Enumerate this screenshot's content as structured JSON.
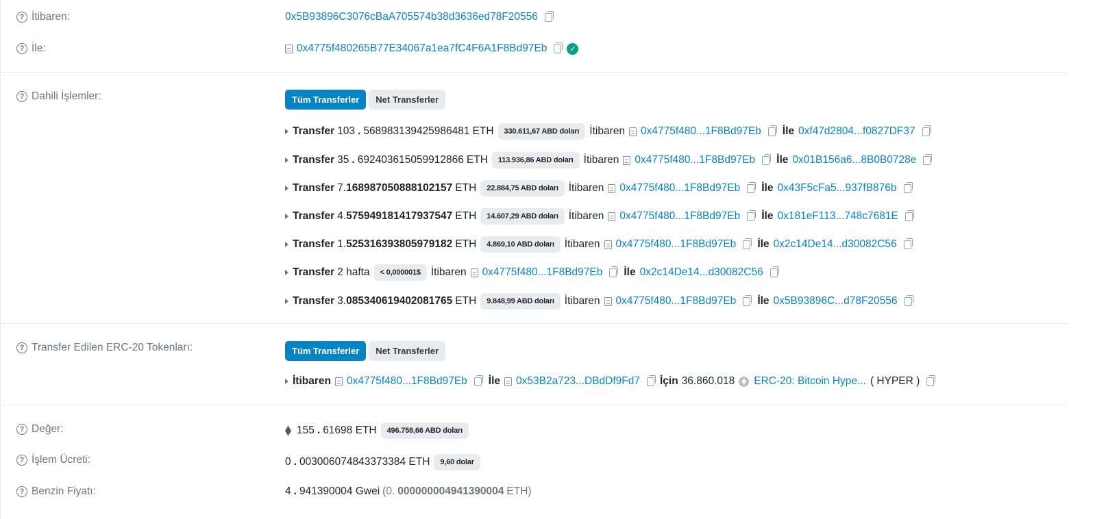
{
  "from": {
    "label": "İtibaren:",
    "address": "0x5B93896C3076cBaA705574b38d3636ed78F20556"
  },
  "to": {
    "label": "İle:",
    "address": "0x4775f480265B77E34067a1ea7fC4F6A1F8Bd97Eb"
  },
  "internal": {
    "label": "Dahili İşlemler:",
    "tab_all": "Tüm Transferler",
    "tab_net": "Net Transferler",
    "transfers": [
      {
        "word": "Transfer",
        "amount_a": "103",
        "amount_b": "568983139425986481",
        "unit": "ETH",
        "usd": "330.611,67 ABD doları",
        "from_label": "İtibaren",
        "from": "0x4775f480...1F8Bd97Eb",
        "to_label": "İle",
        "to": "0xf47d2804...f0827DF37"
      },
      {
        "word": "Transfer",
        "amount_a": "35",
        "amount_b": "692403615059912866",
        "unit": "ETH",
        "usd": "113.936,86 ABD doları",
        "from_label": "İtibaren",
        "from": "0x4775f480...1F8Bd97Eb",
        "to_label": "İle",
        "to": "0x01B156a6...8B0B0728e"
      },
      {
        "word": "Transfer",
        "amount_a": "7.",
        "amount_b": "168987050888102157",
        "unit": "ETH",
        "usd": "22.884,75 ABD doları",
        "from_label": "İtibaren",
        "from": "0x4775f480...1F8Bd97Eb",
        "to_label": "İle",
        "to": "0x43F5cFa5...937fB876b"
      },
      {
        "word": "Transfer",
        "amount_a": "4.",
        "amount_b": "575949181417937547",
        "unit": "ETH",
        "usd": "14.607,29 ABD doları",
        "from_label": "İtibaren",
        "from": "0x4775f480...1F8Bd97Eb",
        "to_label": "İle",
        "to": "0x181eF113...748c7681E"
      },
      {
        "word": "Transfer",
        "amount_a": "1.",
        "amount_b": "525316393805979182",
        "unit": "ETH",
        "usd": "4.869,10 ABD doları",
        "from_label": "İtibaren",
        "from": "0x4775f480...1F8Bd97Eb",
        "to_label": "İle",
        "to": "0x2c14De14...d30082C56"
      },
      {
        "word": "Transfer",
        "amount_a": "2 hafta",
        "amount_b": "",
        "unit": "",
        "usd": "< 0,000001$",
        "from_label": "İtibaren",
        "from": "0x4775f480...1F8Bd97Eb",
        "to_label": "İle",
        "to": "0x2c14De14...d30082C56"
      },
      {
        "word": "Transfer",
        "amount_a": "3.",
        "amount_b": "085340619402081765",
        "unit": "ETH",
        "usd": "9.848,99 ABD doları",
        "from_label": "İtibaren",
        "from": "0x4775f480...1F8Bd97Eb",
        "to_label": "İle",
        "to": "0x5B93896C...d78F20556"
      }
    ]
  },
  "erc20": {
    "label": "Transfer Edilen ERC-20 Tokenları:",
    "tab_all": "Tüm Transferler",
    "tab_net": "Net Transferler",
    "from_label": "İtibaren",
    "from": "0x4775f480...1F8Bd97Eb",
    "to_label": "İle",
    "to": "0x53B2a723...DBdDf9Fd7",
    "for_label": "İçin",
    "amount": "36.860.018",
    "token_name": "ERC-20: Bitcoin Hype...",
    "token_symbol": "( HYPER )"
  },
  "value": {
    "label": "Değer:",
    "amount_a": "155",
    "amount_b": "61698 ETH",
    "usd": "496.758,66 ABD doları"
  },
  "fee": {
    "label": "İşlem Ücreti:",
    "amount_a": "0",
    "amount_b": "003006074843373384 ETH",
    "usd": "9,60 dolar"
  },
  "gas": {
    "label": "Benzin Fiyatı:",
    "amount_a": "4",
    "amount_b": "941390004 Gwei",
    "paren_a": "(0.",
    "paren_b": "000000004941390004",
    "paren_c": "ETH)"
  }
}
